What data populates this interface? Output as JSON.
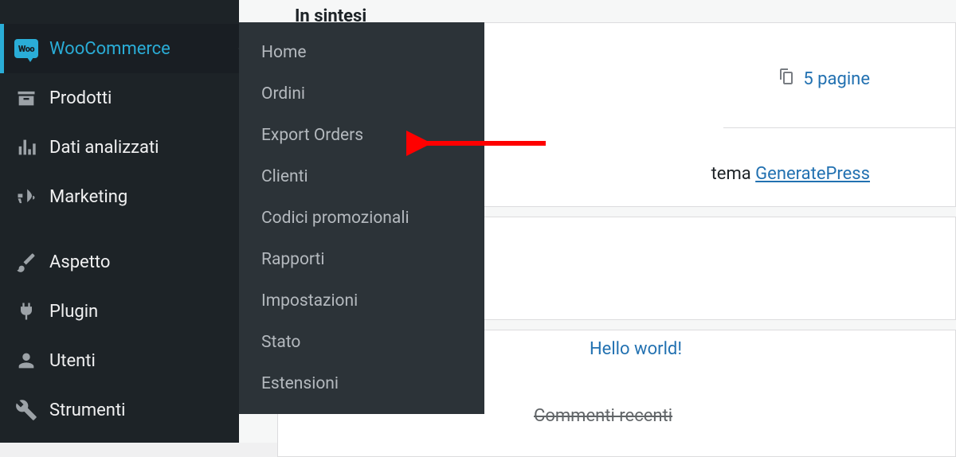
{
  "sidebar": {
    "items": [
      {
        "label": "WooCommerce",
        "icon": "woo"
      },
      {
        "label": "Prodotti",
        "icon": "archive"
      },
      {
        "label": "Dati analizzati",
        "icon": "chart"
      },
      {
        "label": "Marketing",
        "icon": "megaphone"
      },
      {
        "label": "Aspetto",
        "icon": "brush"
      },
      {
        "label": "Plugin",
        "icon": "plug"
      },
      {
        "label": "Utenti",
        "icon": "user"
      },
      {
        "label": "Strumenti",
        "icon": "wrench"
      }
    ]
  },
  "submenu": {
    "items": [
      {
        "label": "Home"
      },
      {
        "label": "Ordini"
      },
      {
        "label": "Export Orders"
      },
      {
        "label": "Clienti"
      },
      {
        "label": "Codici promozionali"
      },
      {
        "label": "Rapporti"
      },
      {
        "label": "Impostazioni"
      },
      {
        "label": "Stato"
      },
      {
        "label": "Estensioni"
      }
    ]
  },
  "content": {
    "widget_title": "In sintesi",
    "pages_label": "5 pagine",
    "theme_prefix": "tema ",
    "theme_name": "GeneratePress",
    "hello_label": "Hello world!",
    "comments_label": "Commenti recenti"
  }
}
